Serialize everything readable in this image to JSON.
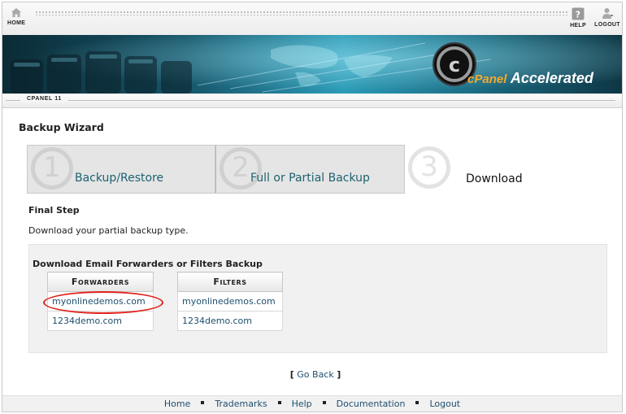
{
  "toolbar": {
    "home_label": "HOME",
    "help_label": "HELP",
    "logout_label": "LOGOUT"
  },
  "banner": {
    "brand_c": "cPanel",
    "brand_name": "Accelerated"
  },
  "version": "CPANEL 11",
  "page_title": "Backup Wizard",
  "steps": [
    {
      "number": "1",
      "label": "Backup/Restore"
    },
    {
      "number": "2",
      "label": "Full or Partial Backup"
    },
    {
      "number": "3",
      "label": "Download"
    }
  ],
  "final_step": {
    "heading": "Final Step",
    "description": "Download your partial backup type."
  },
  "backup_panel": {
    "title": "Download Email Forwarders or Filters Backup",
    "forwarders": {
      "header": "Forwarders",
      "domains": [
        "myonlinedemos.com",
        "1234demo.com"
      ]
    },
    "filters": {
      "header": "Filters",
      "domains": [
        "myonlinedemos.com",
        "1234demo.com"
      ]
    }
  },
  "go_back": {
    "open": "[",
    "label": "Go Back",
    "close": "]"
  },
  "footer": {
    "links": [
      "Home",
      "Trademarks",
      "Help",
      "Documentation",
      "Logout"
    ]
  },
  "colors": {
    "link": "#1d4f6e",
    "highlight_circle": "#e0221b"
  }
}
